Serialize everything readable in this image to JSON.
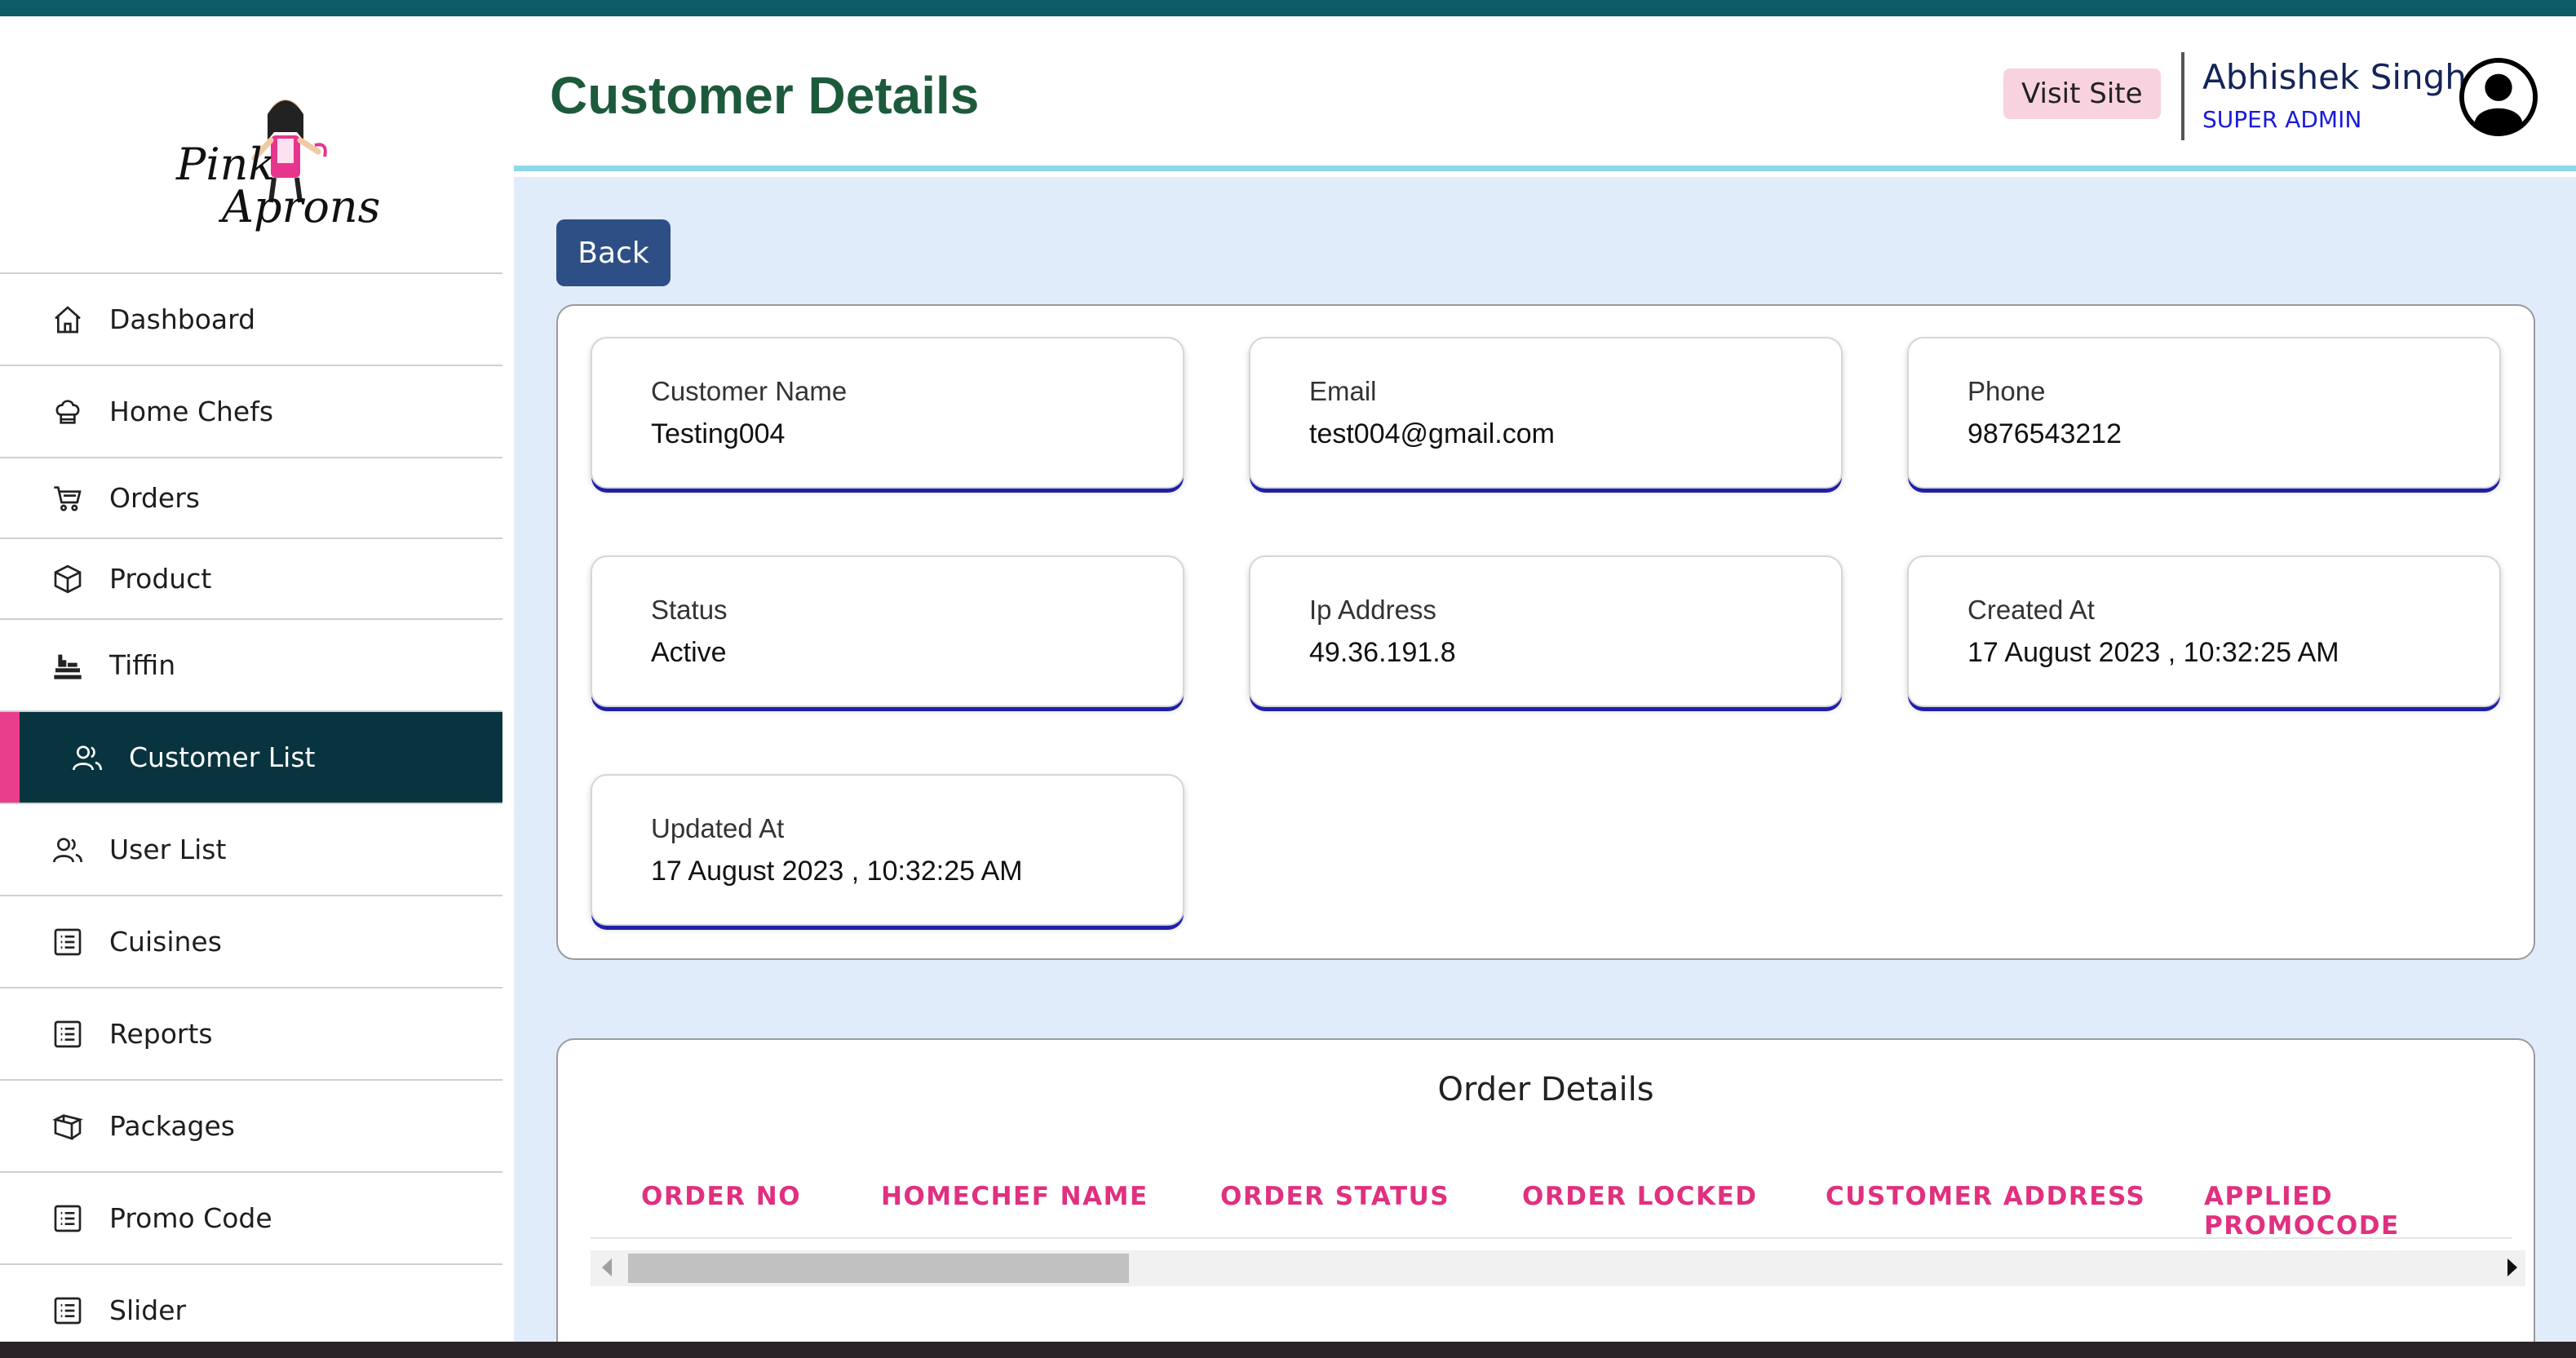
{
  "header": {
    "title": "Customer Details",
    "visit_site": "Visit Site",
    "user_name": "Abhishek Singh",
    "user_role": "SUPER ADMIN"
  },
  "sidebar": {
    "logo_text_1": "Pink",
    "logo_text_2": "Aprons",
    "items": [
      {
        "label": "Dashboard",
        "icon": "home-icon"
      },
      {
        "label": "Home Chefs",
        "icon": "chef-hat-icon"
      },
      {
        "label": "Orders",
        "icon": "cart-icon"
      },
      {
        "label": "Product",
        "icon": "box-icon"
      },
      {
        "label": "Tiffin",
        "icon": "tiffin-icon"
      },
      {
        "label": "Customer List",
        "icon": "users-icon",
        "active": true
      },
      {
        "label": "User List",
        "icon": "users-icon"
      },
      {
        "label": "Cuisines",
        "icon": "list-icon"
      },
      {
        "label": "Reports",
        "icon": "list-icon"
      },
      {
        "label": "Packages",
        "icon": "package-icon"
      },
      {
        "label": "Promo Code",
        "icon": "list-icon"
      },
      {
        "label": "Slider",
        "icon": "list-icon"
      }
    ]
  },
  "main": {
    "back_label": "Back",
    "details": [
      {
        "label": "Customer Name",
        "value": "Testing004"
      },
      {
        "label": "Email",
        "value": "test004@gmail.com"
      },
      {
        "label": "Phone",
        "value": "9876543212"
      },
      {
        "label": "Status",
        "value": "Active"
      },
      {
        "label": "Ip Address",
        "value": "49.36.191.8"
      },
      {
        "label": "Created At",
        "value": "17 August 2023 , 10:32:25 AM"
      },
      {
        "label": "Updated At",
        "value": "17 August 2023 , 10:32:25 AM"
      }
    ],
    "orders": {
      "title": "Order Details",
      "columns": [
        "ORDER NO",
        "HOMECHEF NAME",
        "ORDER STATUS",
        "ORDER LOCKED",
        "CUSTOMER ADDRESS",
        "APPLIED PROMOCODE"
      ]
    }
  },
  "colors": {
    "accent_pink": "#e0307f",
    "title_green": "#1d5a3c",
    "sidebar_active_bg": "#08343f",
    "back_button": "#2e4f85",
    "content_bg": "#e1ecfb"
  }
}
